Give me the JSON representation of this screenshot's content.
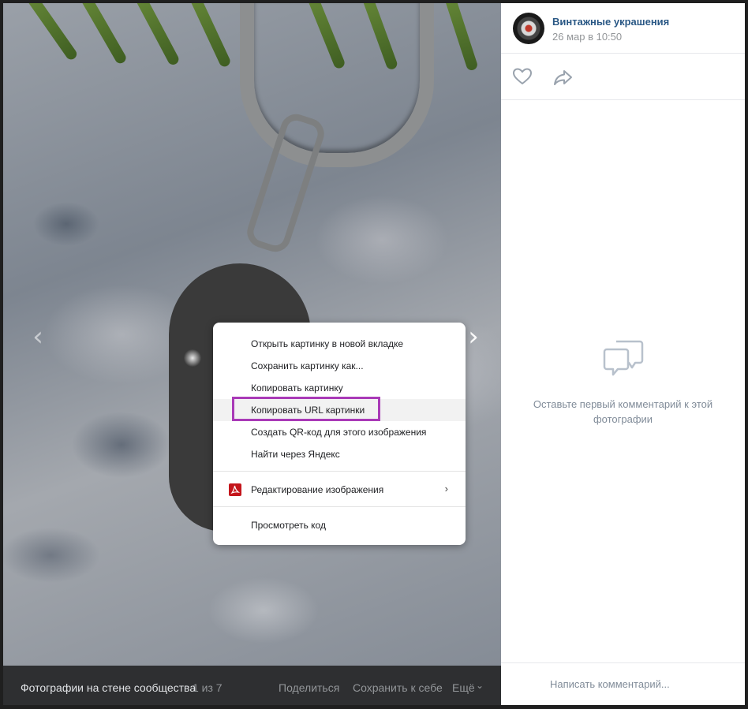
{
  "photo_viewer": {
    "bottom_bar": {
      "album": "Фотографии на стене сообщества",
      "counter": "1 из 7",
      "share": "Поделиться",
      "save": "Сохранить к себе",
      "more": "Ещё"
    }
  },
  "post": {
    "author": "Винтажные украшения",
    "date": "26 мар в 10:50"
  },
  "comments": {
    "empty_text": "Оставьте первый комментарий к этой фотографии",
    "input_placeholder": "Написать комментарий..."
  },
  "context_menu": {
    "items": [
      {
        "label": "Открыть картинку в новой вкладке"
      },
      {
        "label": "Сохранить картинку как..."
      },
      {
        "label": "Копировать картинку"
      },
      {
        "label": "Копировать URL картинки",
        "highlighted": true
      },
      {
        "label": "Создать QR-код для этого изображения"
      },
      {
        "label": "Найти через Яндекс"
      },
      {
        "label": "Редактирование изображения",
        "icon": "adobe-pdf-icon",
        "has_submenu": true
      },
      {
        "label": "Просмотреть код"
      }
    ]
  },
  "colors": {
    "link": "#2a5885",
    "secondary_text": "#939699",
    "highlight_border": "#a93ab7",
    "bottom_bar_bg": "#2e2f31"
  }
}
